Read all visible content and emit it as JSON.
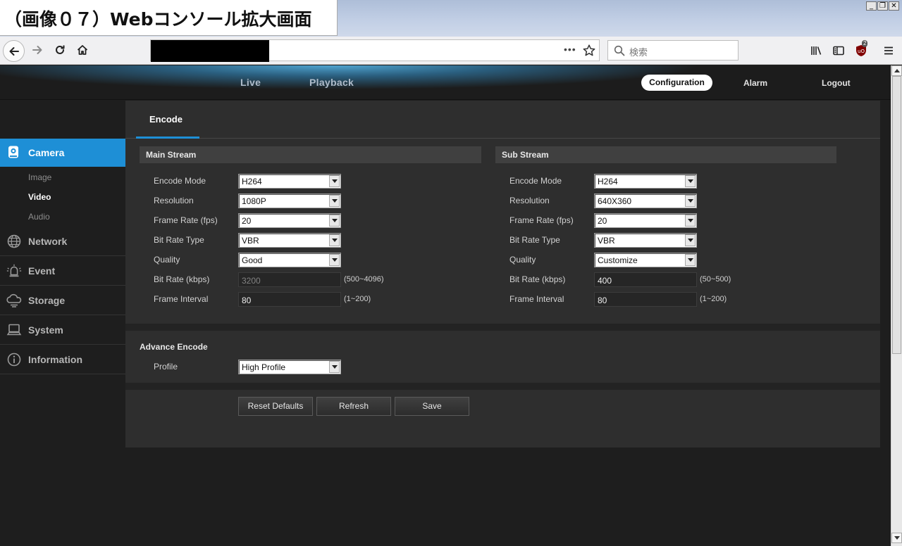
{
  "window": {
    "caption": "（画像０７）Webコンソール拡大画面",
    "controls": [
      "_",
      "❐",
      "✕"
    ]
  },
  "browser": {
    "address_text": "",
    "search_placeholder": "検索",
    "url_menu_glyph": "•••",
    "ublock_badge": "2",
    "icons": [
      "back-icon",
      "forward-icon",
      "reload-icon",
      "home-icon",
      "bookmark-star-icon",
      "search-icon",
      "library-icon",
      "sidebar-icon",
      "ublock-icon",
      "menu-icon"
    ]
  },
  "topnav": {
    "live": "Live",
    "playback": "Playback",
    "configuration": "Configuration",
    "alarm": "Alarm",
    "logout": "Logout"
  },
  "sidebar": {
    "camera": "Camera",
    "camera_items": [
      "Image",
      "Video",
      "Audio"
    ],
    "active_sub": "Video",
    "network": "Network",
    "event": "Event",
    "storage": "Storage",
    "system": "System",
    "information": "Information",
    "accent_color": "#1e8fd6"
  },
  "tabs": {
    "encode": "Encode"
  },
  "main_stream": {
    "title": "Main Stream",
    "encode_mode_label": "Encode Mode",
    "encode_mode": "H264",
    "resolution_label": "Resolution",
    "resolution": "1080P",
    "frame_rate_label": "Frame Rate (fps)",
    "frame_rate": "20",
    "bit_rate_type_label": "Bit Rate Type",
    "bit_rate_type": "VBR",
    "quality_label": "Quality",
    "quality": "Good",
    "bit_rate_label": "Bit Rate (kbps)",
    "bit_rate": "3200",
    "bit_rate_range": "(500~4096)",
    "frame_interval_label": "Frame Interval",
    "frame_interval": "80",
    "frame_interval_range": "(1~200)"
  },
  "sub_stream": {
    "title": "Sub Stream",
    "encode_mode_label": "Encode Mode",
    "encode_mode": "H264",
    "resolution_label": "Resolution",
    "resolution": "640X360",
    "frame_rate_label": "Frame Rate (fps)",
    "frame_rate": "20",
    "bit_rate_type_label": "Bit Rate Type",
    "bit_rate_type": "VBR",
    "quality_label": "Quality",
    "quality": "Customize",
    "bit_rate_label": "Bit Rate (kbps)",
    "bit_rate": "400",
    "bit_rate_range": "(50~500)",
    "frame_interval_label": "Frame Interval",
    "frame_interval": "80",
    "frame_interval_range": "(1~200)"
  },
  "advance": {
    "title": "Advance Encode",
    "profile_label": "Profile",
    "profile": "High Profile"
  },
  "buttons": {
    "reset": "Reset Defaults",
    "refresh": "Refresh",
    "save": "Save"
  }
}
